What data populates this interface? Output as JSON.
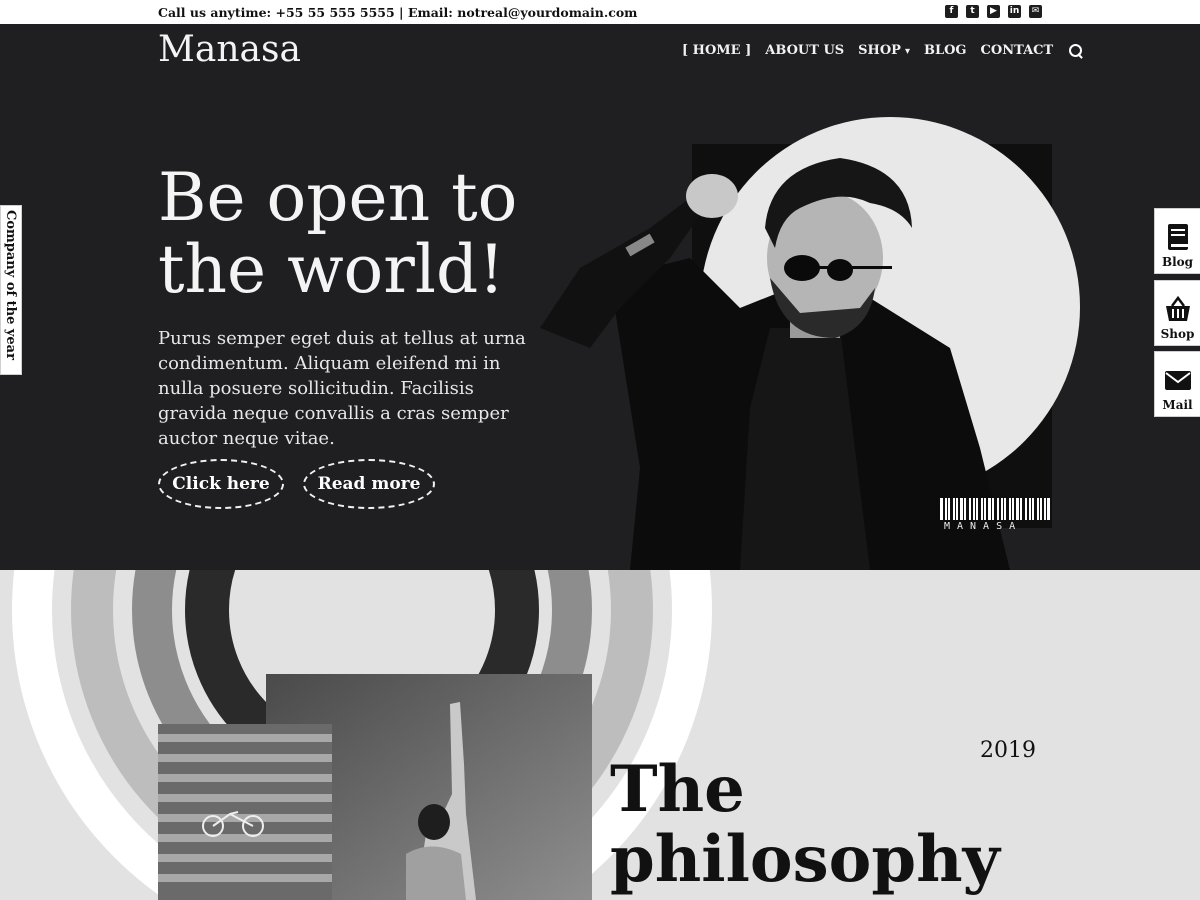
{
  "topbar": {
    "contact_text": "Call us anytime: +55 55 555 5555 | Email: notreal@yourdomain.com",
    "social_icons": [
      "facebook-icon",
      "twitter-icon",
      "youtube-icon",
      "linkedin-icon",
      "mail-icon"
    ]
  },
  "header": {
    "logo": "Manasa",
    "nav": {
      "home": "[ HOME ]",
      "about": "ABOUT US",
      "shop": "SHOP",
      "blog": "BLOG",
      "contact": "CONTACT"
    }
  },
  "hero": {
    "headline": "Be open to the world!",
    "lead": "Purus semper eget duis at tellus at urna condimentum. Aliquam eleifend mi in nulla posuere sollicitudin. Facilisis gravida neque convallis a cras semper auctor neque vitae.",
    "button_primary": "Click here",
    "button_secondary": "Read more",
    "barcode_label": "MANASA"
  },
  "side_tab_left": {
    "label": "Company of the year"
  },
  "side_tabs_right": {
    "blog": "Blog",
    "shop": "Shop",
    "mail": "Mail"
  },
  "philosophy": {
    "year": "2019",
    "title": "The philosophy"
  },
  "colors": {
    "hero_bg": "#1f1e20",
    "section_bg": "#e2e2e2",
    "text_light": "#f4f4f4",
    "text_dark": "#111111"
  }
}
